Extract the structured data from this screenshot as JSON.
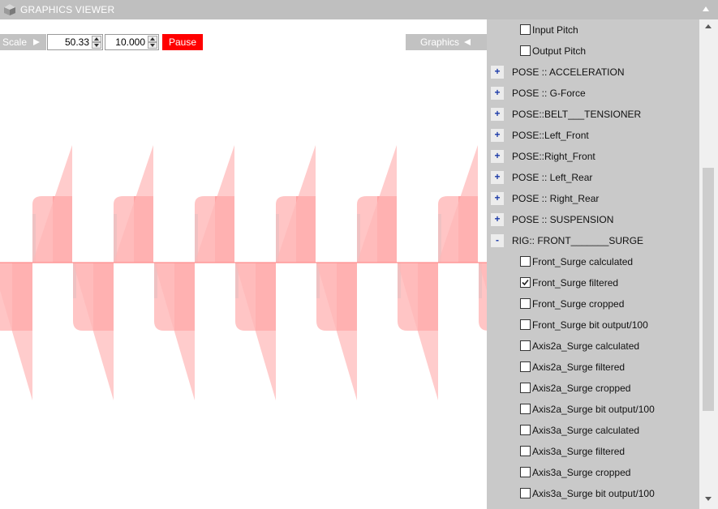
{
  "window": {
    "title": "GRAPHICS VIEWER",
    "app_icon": "cube-icon",
    "collapse_icon": "chevron-up-icon"
  },
  "toolbar": {
    "scale_label": "Scale",
    "scale_value": "50.33",
    "second_value": "10.000",
    "pause_label": "Pause",
    "graphics_label": "Graphics"
  },
  "colors": {
    "pause_bg": "#ff0000",
    "panel_bg": "#c9c9c9",
    "trace_light": "#ffb6b6",
    "trace_dark": "#ff8a8a",
    "trace_cyan": "#8fe4e6"
  },
  "panel": {
    "rows": [
      {
        "kind": "checkbox",
        "label": "Input Pitch",
        "checked": false
      },
      {
        "kind": "checkbox",
        "label": "Output Pitch",
        "checked": false
      },
      {
        "kind": "group",
        "label": "POSE :: ACCELERATION",
        "toggle": "+"
      },
      {
        "kind": "group",
        "label": "POSE :: G-Force",
        "toggle": "+"
      },
      {
        "kind": "group",
        "label": "POSE::BELT___TENSIONER",
        "toggle": "+"
      },
      {
        "kind": "group",
        "label": "POSE::Left_Front",
        "toggle": "+"
      },
      {
        "kind": "group",
        "label": "POSE::Right_Front",
        "toggle": "+"
      },
      {
        "kind": "group",
        "label": "POSE :: Left_Rear",
        "toggle": "+"
      },
      {
        "kind": "group",
        "label": "POSE :: Right_Rear",
        "toggle": "+"
      },
      {
        "kind": "group",
        "label": "POSE ::  SUSPENSION",
        "toggle": "+"
      },
      {
        "kind": "group",
        "label": "RIG:: FRONT_______SURGE",
        "toggle": "-"
      },
      {
        "kind": "checkbox",
        "label": "Front_Surge calculated",
        "checked": false
      },
      {
        "kind": "checkbox",
        "label": "Front_Surge filtered",
        "checked": true
      },
      {
        "kind": "checkbox",
        "label": "Front_Surge cropped",
        "checked": false
      },
      {
        "kind": "checkbox",
        "label": "Front_Surge bit output/100",
        "checked": false
      },
      {
        "kind": "checkbox",
        "label": "Axis2a_Surge calculated",
        "checked": false
      },
      {
        "kind": "checkbox",
        "label": "Axis2a_Surge filtered",
        "checked": false
      },
      {
        "kind": "checkbox",
        "label": "Axis2a_Surge cropped",
        "checked": false
      },
      {
        "kind": "checkbox",
        "label": "Axis2a_Surge bit output/100",
        "checked": false
      },
      {
        "kind": "checkbox",
        "label": "Axis3a_Surge calculated",
        "checked": false
      },
      {
        "kind": "checkbox",
        "label": "Axis3a_Surge filtered",
        "checked": false
      },
      {
        "kind": "checkbox",
        "label": "Axis3a_Surge cropped",
        "checked": false
      },
      {
        "kind": "checkbox",
        "label": "Axis3a_Surge bit output/100",
        "checked": false
      }
    ]
  }
}
